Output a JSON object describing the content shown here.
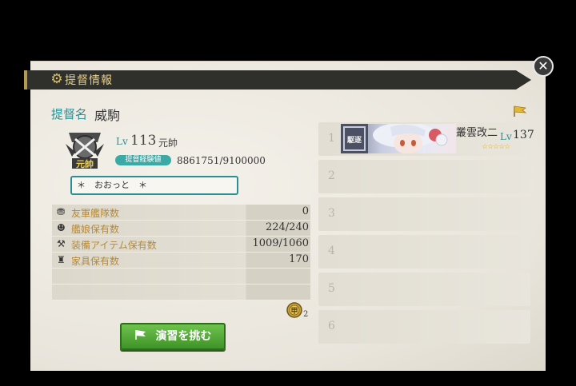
{
  "header": {
    "title": "提督情報"
  },
  "admiral": {
    "name_label": "提督名",
    "name": "威駒",
    "lv_label": "Lv",
    "level": "113",
    "rank": "元帥",
    "rank_emblem_text": "元帥",
    "exp_label": "提督経験値",
    "exp": "8861751/9100000",
    "comment": "＊　おおっと　＊"
  },
  "stats": [
    {
      "icon": "fleet-icon",
      "label": "友軍艦隊数",
      "value": "0"
    },
    {
      "icon": "shipgirl-icon",
      "label": "艦娘保有数",
      "value": "224/240"
    },
    {
      "icon": "equipment-icon",
      "label": "装備アイテム保有数",
      "value": "1009/1060"
    },
    {
      "icon": "furniture-icon",
      "label": "家具保有数",
      "value": "170"
    },
    {
      "icon": "",
      "label": "",
      "value": ""
    },
    {
      "icon": "",
      "label": "",
      "value": ""
    }
  ],
  "medals": {
    "count": "2",
    "icon_text": "甲"
  },
  "exercise_button": {
    "label": "演習を挑む"
  },
  "fleet": {
    "slots": [
      {
        "num": "1",
        "ship_name": "叢雲改二",
        "lv_label": "Lv",
        "level": "137",
        "stars": "☆☆☆☆☆",
        "banner_tag": "駆逐"
      },
      {
        "num": "2"
      },
      {
        "num": "3"
      },
      {
        "num": "4"
      },
      {
        "num": "5"
      },
      {
        "num": "6"
      }
    ]
  },
  "colors": {
    "accent": "#2e8f93",
    "gold": "#b4893a",
    "button_green": "#4fa533"
  }
}
